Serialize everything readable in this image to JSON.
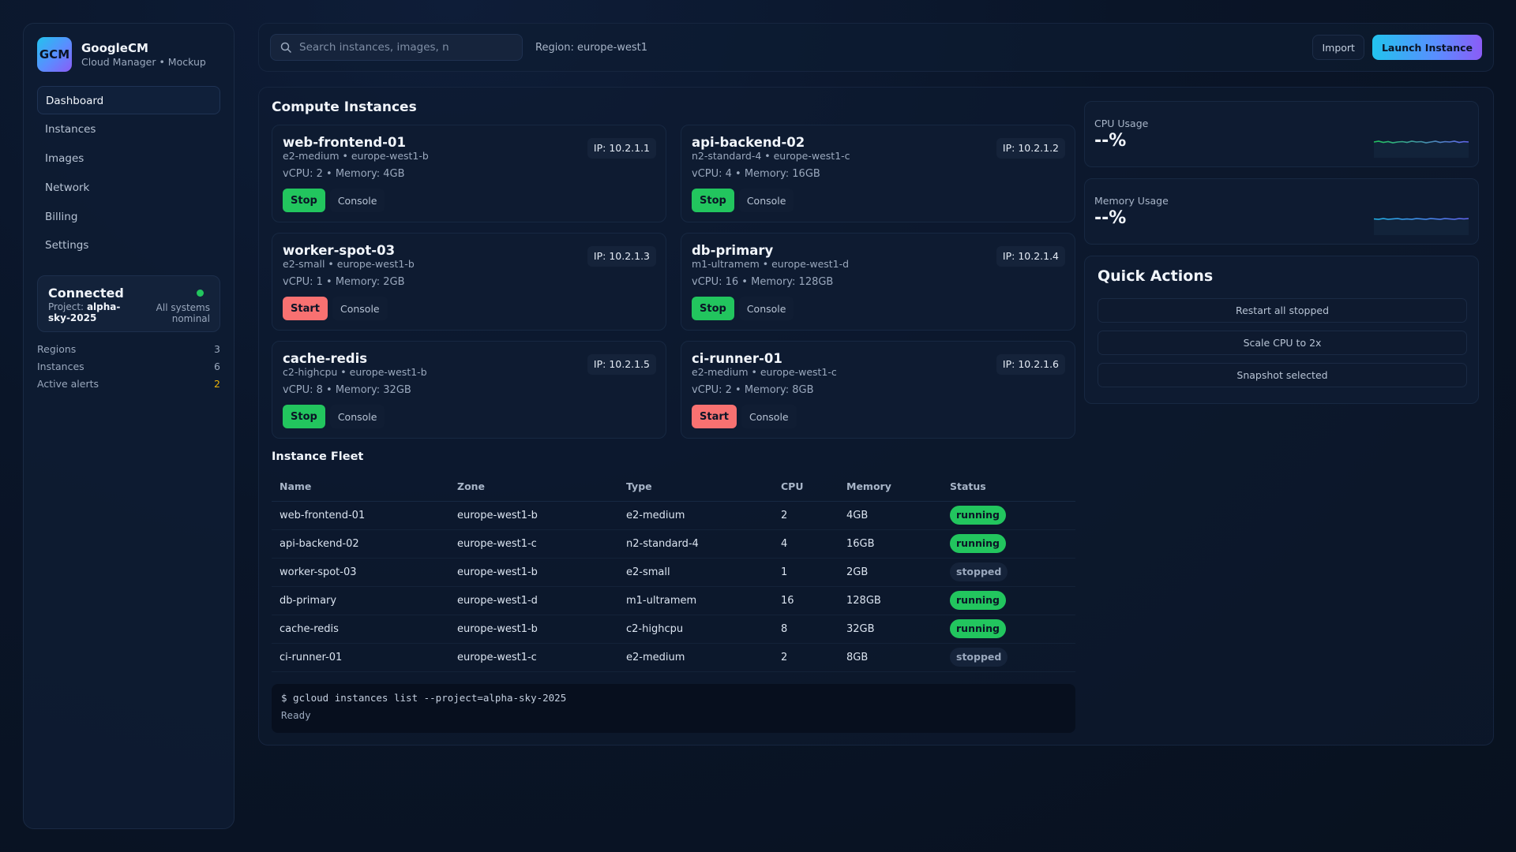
{
  "brand": {
    "logo": "GCM",
    "name": "GoogleCM",
    "subtitle": "Cloud Manager • Mockup"
  },
  "nav": [
    "Dashboard",
    "Instances",
    "Images",
    "Network",
    "Billing",
    "Settings"
  ],
  "status": {
    "title": "Connected",
    "project_label": "Project:",
    "project": "alpha-sky-2025",
    "note": "All systems nominal",
    "dot_color": "#22c55e"
  },
  "stats": [
    {
      "label": "Regions",
      "value": "3"
    },
    {
      "label": "Instances",
      "value": "6"
    },
    {
      "label": "Active alerts",
      "value": "2"
    }
  ],
  "topbar": {
    "search_placeholder": "Search instances, images, n",
    "search_icon": "search-icon",
    "region": "Region: europe-west1",
    "import_label": "Import",
    "launch_label": "Launch Instance"
  },
  "compute": {
    "title": "Compute Instances",
    "console_label": "Console",
    "instances": [
      {
        "name": "web-frontend-01",
        "sub": "e2-medium • europe-west1-b",
        "specs": "vCPU: 2 • Memory: 4GB",
        "ip": "IP: 10.2.1.1",
        "action": "Stop"
      },
      {
        "name": "api-backend-02",
        "sub": "n2-standard-4 • europe-west1-c",
        "specs": "vCPU: 4 • Memory: 16GB",
        "ip": "IP: 10.2.1.2",
        "action": "Stop"
      },
      {
        "name": "worker-spot-03",
        "sub": "e2-small • europe-west1-b",
        "specs": "vCPU: 1 • Memory: 2GB",
        "ip": "IP: 10.2.1.3",
        "action": "Start"
      },
      {
        "name": "db-primary",
        "sub": "m1-ultramem • europe-west1-d",
        "specs": "vCPU: 16 • Memory: 128GB",
        "ip": "IP: 10.2.1.4",
        "action": "Stop"
      },
      {
        "name": "cache-redis",
        "sub": "c2-highcpu • europe-west1-b",
        "specs": "vCPU: 8 • Memory: 32GB",
        "ip": "IP: 10.2.1.5",
        "action": "Stop"
      },
      {
        "name": "ci-runner-01",
        "sub": "e2-medium • europe-west1-c",
        "specs": "vCPU: 2 • Memory: 8GB",
        "ip": "IP: 10.2.1.6",
        "action": "Start"
      }
    ]
  },
  "fleet": {
    "title": "Instance Fleet",
    "columns": [
      "Name",
      "Zone",
      "Type",
      "CPU",
      "Memory",
      "Status"
    ],
    "rows": [
      [
        "web-frontend-01",
        "europe-west1-b",
        "e2-medium",
        "2",
        "4GB",
        "running"
      ],
      [
        "api-backend-02",
        "europe-west1-c",
        "n2-standard-4",
        "4",
        "16GB",
        "running"
      ],
      [
        "worker-spot-03",
        "europe-west1-b",
        "e2-small",
        "1",
        "2GB",
        "stopped"
      ],
      [
        "db-primary",
        "europe-west1-d",
        "m1-ultramem",
        "16",
        "128GB",
        "running"
      ],
      [
        "cache-redis",
        "europe-west1-b",
        "c2-highcpu",
        "8",
        "32GB",
        "running"
      ],
      [
        "ci-runner-01",
        "europe-west1-c",
        "e2-medium",
        "2",
        "8GB",
        "stopped"
      ]
    ]
  },
  "terminal": {
    "command": "$ gcloud instances list --project=alpha-sky-2025",
    "output": "Ready"
  },
  "metrics": [
    {
      "label": "CPU Usage",
      "value": "--%"
    },
    {
      "label": "Memory Usage",
      "value": "--%"
    }
  ],
  "quick_actions": {
    "title": "Quick Actions",
    "buttons": [
      "Restart all stopped",
      "Scale CPU to 2x",
      "Snapshot selected"
    ]
  },
  "colors": {
    "running": "#22c55e",
    "stop_button": "#22c55e",
    "start_button": "#f87171",
    "accent_gradient_start": "#22c3ee",
    "accent_gradient_end": "#8b5cf6",
    "alert": "#eab308"
  }
}
